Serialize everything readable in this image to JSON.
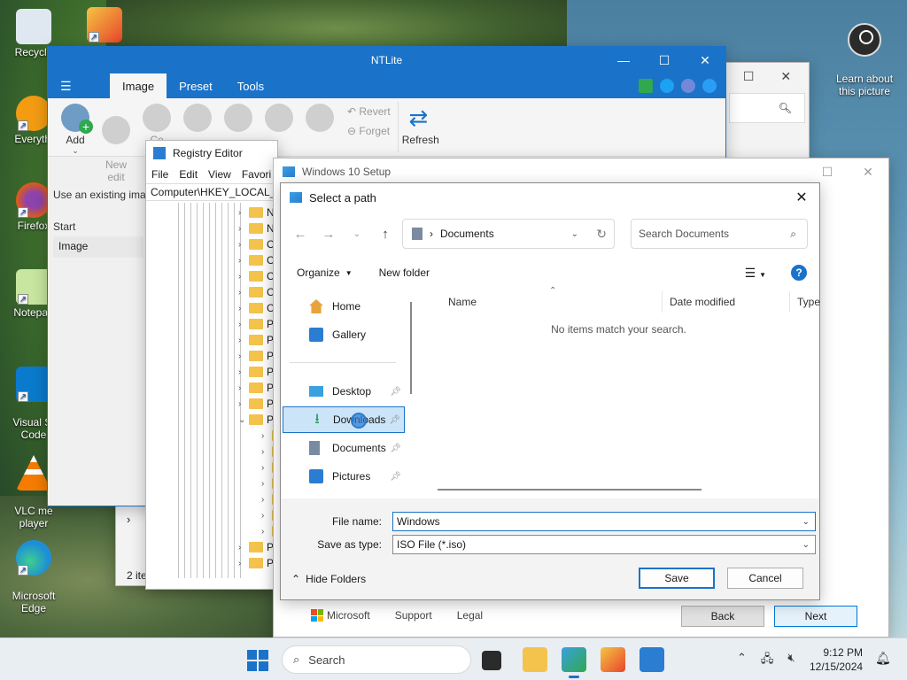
{
  "desktop": {
    "icons": [
      {
        "label": "Recycle",
        "color": "#e9eef3"
      },
      {
        "label": "Everythi",
        "color": "#f39c12"
      },
      {
        "label": "Firefox",
        "color": "#e55b13"
      },
      {
        "label": "Notepad",
        "color": "#8bc34a"
      },
      {
        "label": "Visual St\nCode",
        "color": "#0a7acc"
      },
      {
        "label": "VLC me\nplayer",
        "color": "#f57c00"
      },
      {
        "label": "Microsoft\nEdge",
        "color": "#1d8fd6"
      }
    ],
    "learn_label": "Learn about\nthis picture"
  },
  "ntlite": {
    "title": "NTLite",
    "tabs": [
      "Image",
      "Preset",
      "Tools"
    ],
    "ribbon": {
      "add": "Add",
      "new_edit": "New\nedit",
      "partial": "Co",
      "revert": "Revert",
      "forget": "Forget",
      "refresh": "Refresh"
    },
    "hint": "Use an existing imag",
    "start_label": "Start",
    "image_item": "Image"
  },
  "bg_window": {
    "items_count": "2 ite"
  },
  "regedit": {
    "title": "Registry Editor",
    "menu": [
      "File",
      "Edit",
      "View",
      "Favori"
    ],
    "address": "Computer\\HKEY_LOCAL_",
    "rows": [
      "N",
      "N",
      "C",
      "C",
      "C",
      "C",
      "C",
      "P",
      "P",
      "P",
      "P",
      "P",
      "P",
      "P",
      "",
      "",
      "",
      "",
      "",
      "",
      "",
      "P",
      "P"
    ]
  },
  "setup": {
    "title": "Windows 10 Setup",
    "footer": {
      "microsoft": "Microsoft",
      "support": "Support",
      "legal": "Legal"
    },
    "back": "Back",
    "next": "Next"
  },
  "dialog": {
    "title": "Select a path",
    "location": "Documents",
    "search_placeholder": "Search Documents",
    "organize": "Organize",
    "new_folder": "New folder",
    "nav": {
      "home": "Home",
      "gallery": "Gallery",
      "desktop": "Desktop",
      "downloads": "Downloads",
      "documents": "Documents",
      "pictures": "Pictures"
    },
    "columns": {
      "name": "Name",
      "date": "Date modified",
      "type": "Type"
    },
    "empty": "No items match your search.",
    "file_name_label": "File name:",
    "file_name_value": "Windows",
    "save_type_label": "Save as type:",
    "save_type_value": "ISO File (*.iso)",
    "hide_folders": "Hide Folders",
    "save": "Save",
    "cancel": "Cancel"
  },
  "taskbar": {
    "search": "Search",
    "time": "9:12 PM",
    "date": "12/15/2024"
  },
  "icons": {
    "start": "windows-start-icon",
    "search": "search-icon",
    "help": "help-icon",
    "close": "close-icon"
  }
}
